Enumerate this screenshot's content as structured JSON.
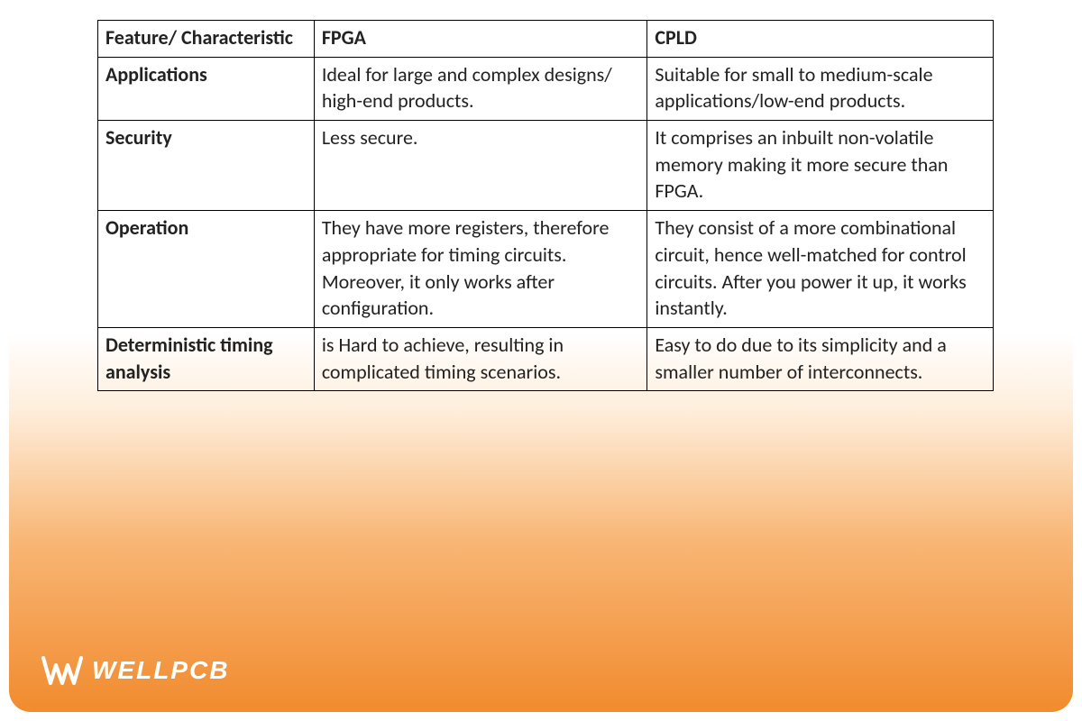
{
  "table": {
    "headers": [
      "Feature/ Characteristic",
      "FPGA",
      "CPLD"
    ],
    "rows": [
      {
        "feature": "Applications",
        "fpga": "Ideal for large and complex designs/ high-end products.",
        "cpld": "Suitable for small to medium-scale applications/low-end products."
      },
      {
        "feature": "Security",
        "fpga": "Less secure.",
        "cpld": "It comprises an inbuilt non-volatile memory making it more secure than FPGA."
      },
      {
        "feature": "Operation",
        "fpga": "They have more registers, therefore appropriate for timing circuits. Moreover, it only works after configuration.",
        "cpld": "They consist of a more combinational circuit, hence well-matched for control circuits. After you power it up, it works instantly."
      },
      {
        "feature": "Deterministic timing analysis",
        "fpga": "is Hard to achieve, resulting in complicated timing scenarios.",
        "cpld": "Easy to do due to its simplicity and a smaller number of interconnects."
      }
    ]
  },
  "brand": {
    "name": "WELLPCB"
  }
}
